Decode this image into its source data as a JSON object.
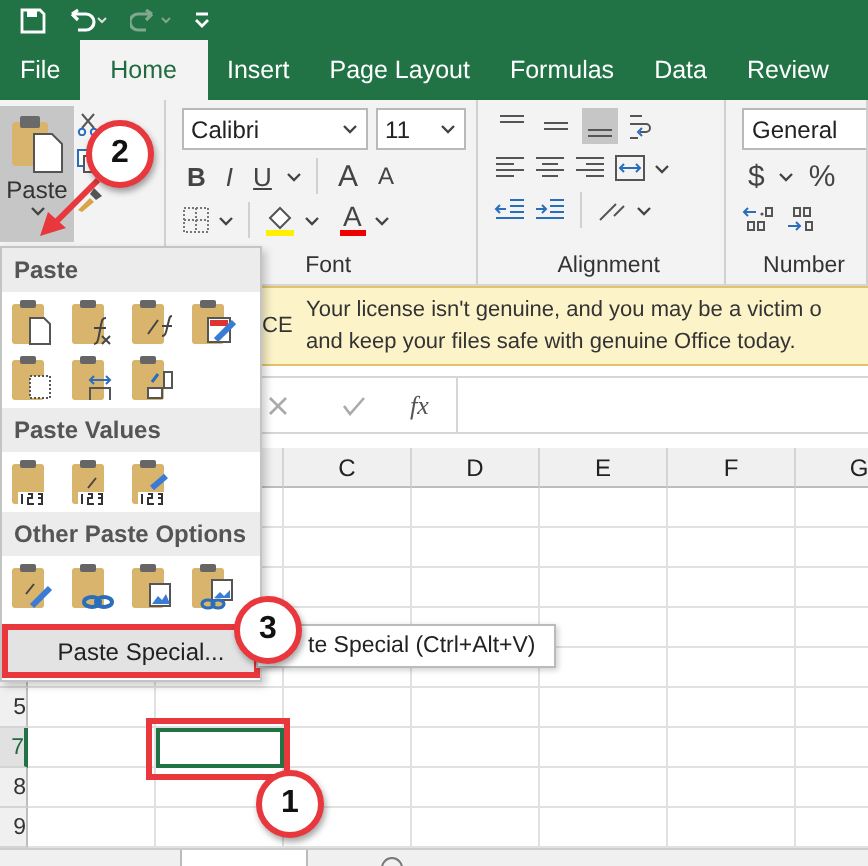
{
  "tabs": [
    {
      "label": "File",
      "selected": false
    },
    {
      "label": "Home",
      "selected": true
    },
    {
      "label": "Insert",
      "selected": false
    },
    {
      "label": "Page Layout",
      "selected": false
    },
    {
      "label": "Formulas",
      "selected": false
    },
    {
      "label": "Data",
      "selected": false
    },
    {
      "label": "Review",
      "selected": false
    }
  ],
  "ribbon": {
    "clipboard": {
      "paste_label": "Paste",
      "paste_pressed": true
    },
    "font": {
      "name": "Calibri",
      "size": "11",
      "format_buttons": [
        "B",
        "I",
        "U"
      ],
      "grow": "A",
      "shrink": "A",
      "color_letter": "A",
      "label": "Font"
    },
    "alignment": {
      "vertical_align": [
        {
          "selected": false
        },
        {
          "selected": false
        },
        {
          "selected": true
        }
      ],
      "label": "Alignment"
    },
    "number": {
      "format": "General",
      "currency": "$",
      "percent": "%",
      "label": "Number"
    }
  },
  "message_bar": {
    "title": "CE",
    "lines": [
      "Your license isn't genuine, and you may be a victim o",
      "and keep your files safe with genuine Office today."
    ]
  },
  "formula_bar": {
    "function_label": "fx"
  },
  "grid": {
    "columns": [
      "C",
      "D",
      "E",
      "F",
      "G"
    ],
    "rows": [
      {
        "label": "5",
        "selected": false
      },
      {
        "label": "7",
        "selected": true
      },
      {
        "label": "8",
        "selected": false
      },
      {
        "label": "9",
        "selected": false
      }
    ]
  },
  "paste_menu": {
    "sections": [
      {
        "title": "Paste"
      },
      {
        "title": "Paste Values"
      },
      {
        "title": "Other Paste Options"
      }
    ],
    "paste_special": {
      "label": "Paste Special...",
      "highlighted": true
    }
  },
  "tooltip": "te Special (Ctrl+Alt+V)",
  "callouts": [
    {
      "number": "2"
    },
    {
      "number": "3"
    },
    {
      "number": "1"
    }
  ]
}
